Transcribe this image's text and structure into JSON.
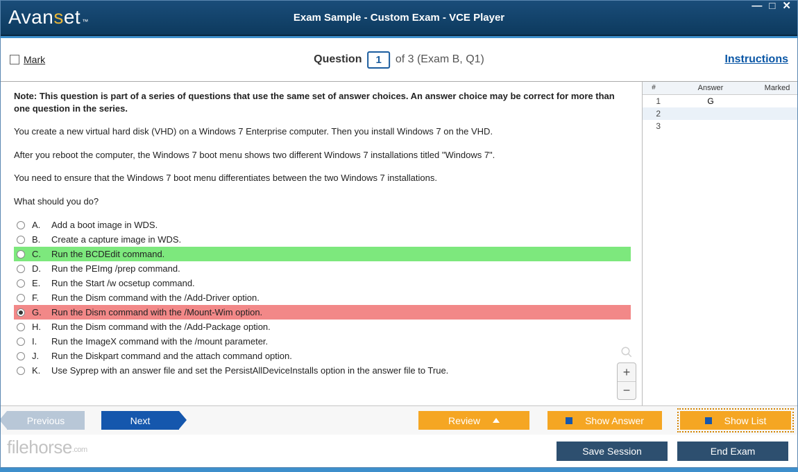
{
  "logo": {
    "text": "Avanset",
    "tm": "™"
  },
  "title": "Exam Sample - Custom Exam - VCE Player",
  "win": {
    "min": "—",
    "max": "□",
    "close": "✕"
  },
  "toolbar": {
    "mark_label": "Mark",
    "question_label": "Question",
    "question_number": "1",
    "question_rest": "of 3 (Exam B, Q1)",
    "instructions": "Instructions"
  },
  "question": {
    "note": "Note: This question is part of a series of questions that use the same set of answer choices. An answer choice may be correct for more than one question in the series.",
    "p1": "You create a new virtual hard disk (VHD) on a Windows 7 Enterprise computer. Then you install Windows 7 on the VHD.",
    "p2": "After you reboot the computer, the Windows 7 boot menu shows two different Windows 7 installations titled \"Windows 7\".",
    "p3": "You need to ensure that the Windows 7 boot menu differentiates between the two Windows 7 installations.",
    "p4": "What should you do?",
    "answers": [
      {
        "letter": "A.",
        "text": "Add a boot image in WDS.",
        "state": ""
      },
      {
        "letter": "B.",
        "text": "Create a capture image in WDS.",
        "state": ""
      },
      {
        "letter": "C.",
        "text": "Run the BCDEdit command.",
        "state": "correct"
      },
      {
        "letter": "D.",
        "text": "Run the PEImg /prep command.",
        "state": ""
      },
      {
        "letter": "E.",
        "text": "Run the Start /w ocsetup command.",
        "state": ""
      },
      {
        "letter": "F.",
        "text": "Run the Dism command with the /Add-Driver option.",
        "state": ""
      },
      {
        "letter": "G.",
        "text": "Run the Dism command with the /Mount-Wim option.",
        "state": "wrong"
      },
      {
        "letter": "H.",
        "text": "Run the Dism command with the /Add-Package option.",
        "state": ""
      },
      {
        "letter": "I.",
        "text": "Run the ImageX command with the /mount parameter.",
        "state": ""
      },
      {
        "letter": "J.",
        "text": "Run the Diskpart command and the attach command option.",
        "state": ""
      },
      {
        "letter": "K.",
        "text": "Use Syprep with an answer file and set the PersistAllDeviceInstalls option in the answer file to True.",
        "state": ""
      }
    ]
  },
  "side": {
    "header": {
      "num": "#",
      "answer": "Answer",
      "marked": "Marked"
    },
    "rows": [
      {
        "num": "1",
        "answer": "G",
        "marked": ""
      },
      {
        "num": "2",
        "answer": "",
        "marked": ""
      },
      {
        "num": "3",
        "answer": "",
        "marked": ""
      }
    ]
  },
  "nav": {
    "previous": "Previous",
    "next": "Next",
    "review": "Review",
    "show_answer": "Show Answer",
    "show_list": "Show List"
  },
  "bottom": {
    "save_session": "Save Session",
    "end_exam": "End Exam"
  },
  "watermark": {
    "text": "filehorse",
    "suffix": ".com"
  }
}
